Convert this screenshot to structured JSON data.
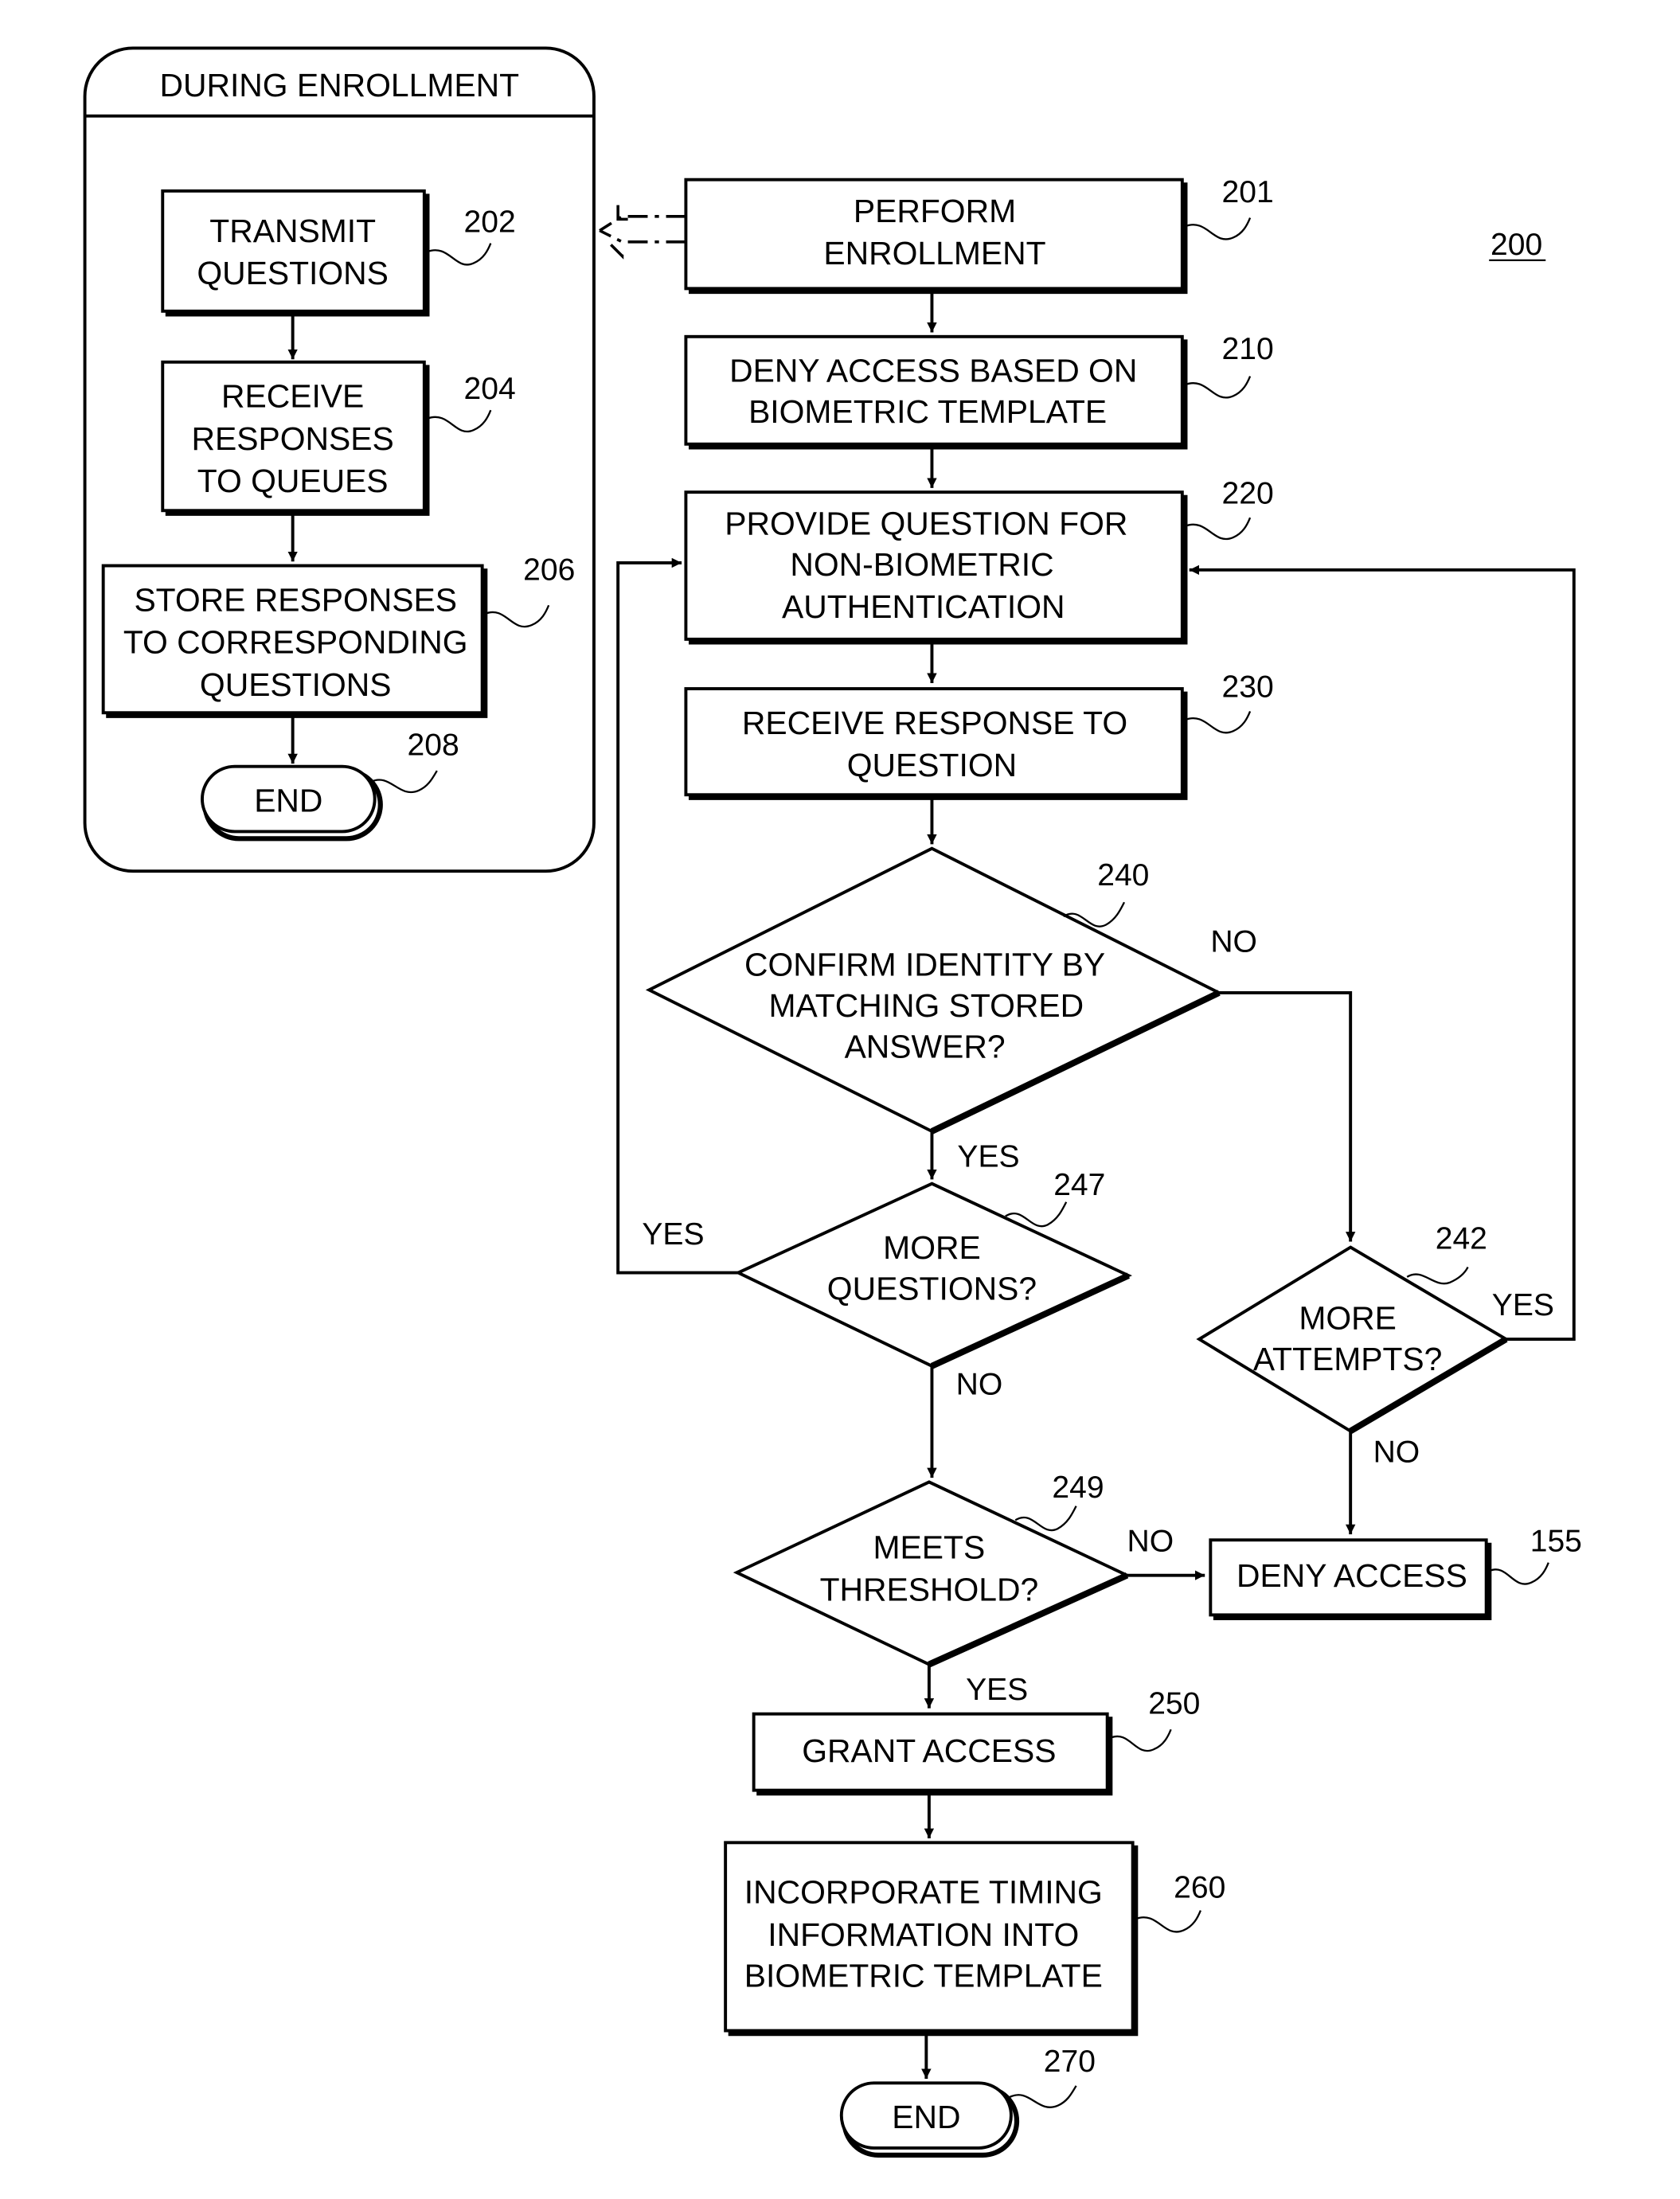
{
  "figure": {
    "number": "200",
    "panel": {
      "title": "DURING ENROLLMENT",
      "steps": [
        {
          "id": "202",
          "lines": [
            "TRANSMIT",
            "QUESTIONS"
          ]
        },
        {
          "id": "204",
          "lines": [
            "RECEIVE",
            "RESPONSES",
            "TO QUEUES"
          ]
        },
        {
          "id": "206",
          "lines": [
            "STORE RESPONSES",
            "TO CORRESPONDING",
            "QUESTIONS"
          ]
        },
        {
          "id": "208",
          "lines": [
            "END"
          ]
        }
      ]
    },
    "steps": [
      {
        "id": "201",
        "lines": [
          "PERFORM",
          "ENROLLMENT"
        ]
      },
      {
        "id": "210",
        "lines": [
          "DENY ACCESS BASED ON",
          "BIOMETRIC TEMPLATE"
        ]
      },
      {
        "id": "220",
        "lines": [
          "PROVIDE QUESTION FOR",
          "NON-BIOMETRIC",
          "AUTHENTICATION"
        ]
      },
      {
        "id": "230",
        "lines": [
          "RECEIVE RESPONSE TO",
          "QUESTION"
        ]
      },
      {
        "id": "240",
        "lines": [
          "CONFIRM IDENTITY BY",
          "MATCHING STORED",
          "ANSWER?"
        ]
      },
      {
        "id": "247",
        "lines": [
          "MORE",
          "QUESTIONS?"
        ]
      },
      {
        "id": "242",
        "lines": [
          "MORE",
          "ATTEMPTS?"
        ]
      },
      {
        "id": "249",
        "lines": [
          "MEETS",
          "THRESHOLD?"
        ]
      },
      {
        "id": "155",
        "lines": [
          "DENY ACCESS"
        ]
      },
      {
        "id": "250",
        "lines": [
          "GRANT ACCESS"
        ]
      },
      {
        "id": "260",
        "lines": [
          "INCORPORATE TIMING",
          "INFORMATION INTO",
          "BIOMETRIC TEMPLATE"
        ]
      },
      {
        "id": "270",
        "lines": [
          "END"
        ]
      }
    ],
    "edge_labels": {
      "d240_no": "NO",
      "d240_yes": "YES",
      "d247_yes": "YES",
      "d247_no": "NO",
      "d242_yes": "YES",
      "d242_no": "NO",
      "d249_no": "NO",
      "d249_yes": "YES"
    }
  }
}
